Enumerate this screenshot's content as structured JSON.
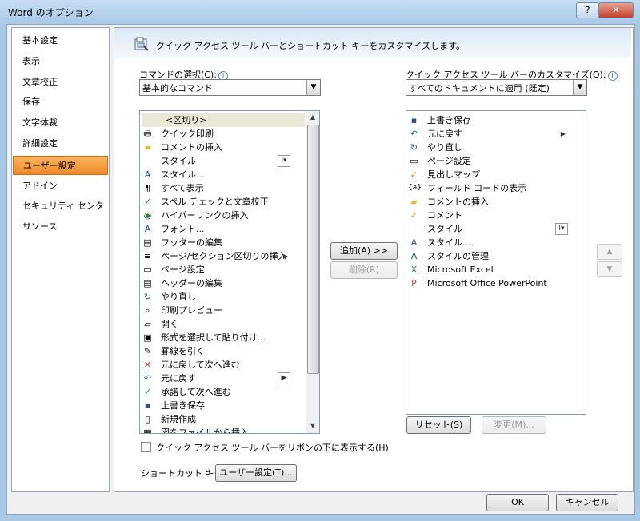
{
  "window": {
    "title": "Word のオプション",
    "help_label": "?",
    "close_label": "✕"
  },
  "nav": {
    "items": [
      {
        "label": "基本設定"
      },
      {
        "label": "表示"
      },
      {
        "label": "文章校正"
      },
      {
        "label": "保存"
      },
      {
        "label": "文字体裁"
      },
      {
        "label": "詳細設定"
      },
      {
        "label": "ユーザー設定",
        "selected": true
      },
      {
        "label": "アドイン"
      },
      {
        "label": "セキュリティ センター"
      },
      {
        "label": "リソース"
      }
    ]
  },
  "header": {
    "text": "クイック アクセス ツール バーとショートカット キーをカスタマイズします。"
  },
  "left": {
    "label": "コマンドの選択(C):",
    "combo_value": "基本的なコマンド",
    "commands": [
      {
        "label": "<区切り>",
        "icon": "separator"
      },
      {
        "label": "クイック印刷",
        "icon": "print-icon"
      },
      {
        "label": "コメントの挿入",
        "icon": "folder-icon"
      },
      {
        "label": "スタイル",
        "icon": "none",
        "dropdown": true
      },
      {
        "label": "スタイル...",
        "icon": "style-icon"
      },
      {
        "label": "すべて表示",
        "icon": "paragraph-icon"
      },
      {
        "label": "スペル チェックと文章校正",
        "icon": "spellcheck-icon"
      },
      {
        "label": "ハイパーリンクの挿入",
        "icon": "globe-icon"
      },
      {
        "label": "フォント...",
        "icon": "font-icon"
      },
      {
        "label": "フッターの編集",
        "icon": "footer-icon"
      },
      {
        "label": "ページ/セクション区切りの挿入",
        "icon": "break-icon",
        "submenu": true
      },
      {
        "label": "ページ設定",
        "icon": "page-setup-icon"
      },
      {
        "label": "ヘッダーの編集",
        "icon": "header-icon"
      },
      {
        "label": "やり直し",
        "icon": "redo-icon"
      },
      {
        "label": "印刷プレビュー",
        "icon": "preview-icon"
      },
      {
        "label": "開く",
        "icon": "open-icon"
      },
      {
        "label": "形式を選択して貼り付け...",
        "icon": "paste-icon"
      },
      {
        "label": "罫線を引く",
        "icon": "table-draw-icon"
      },
      {
        "label": "元に戻して次へ進む",
        "icon": "reject-icon"
      },
      {
        "label": "元に戻す",
        "icon": "undo-icon",
        "submenu_box": true
      },
      {
        "label": "承諾して次へ進む",
        "icon": "accept-icon"
      },
      {
        "label": "上書き保存",
        "icon": "save-icon"
      },
      {
        "label": "新規作成",
        "icon": "new-icon"
      },
      {
        "label": "図をファイルから挿入",
        "icon": "picture-icon"
      }
    ]
  },
  "right": {
    "label": "クイック アクセス ツール バーのカスタマイズ(Q):",
    "combo_value": "すべてのドキュメントに適用 (既定)",
    "items": [
      {
        "label": "上書き保存",
        "icon": "save-icon"
      },
      {
        "label": "元に戻す",
        "icon": "undo-icon",
        "submenu": true
      },
      {
        "label": "やり直し",
        "icon": "redo-icon"
      },
      {
        "label": "ページ設定",
        "icon": "page-setup-icon"
      },
      {
        "label": "見出しマップ",
        "icon": "check-icon"
      },
      {
        "label": "フィールド コードの表示",
        "icon": "field-code-icon"
      },
      {
        "label": "コメントの挿入",
        "icon": "folder-icon"
      },
      {
        "label": "コメント",
        "icon": "check-icon"
      },
      {
        "label": "スタイル",
        "icon": "none",
        "dropdown": true
      },
      {
        "label": "スタイル...",
        "icon": "style-icon"
      },
      {
        "label": "スタイルの管理",
        "icon": "manage-styles-icon"
      },
      {
        "label": "Microsoft Excel",
        "icon": "excel-icon"
      },
      {
        "label": "Microsoft Office PowerPoint",
        "icon": "powerpoint-icon"
      }
    ]
  },
  "buttons": {
    "add": "追加(A) >>",
    "remove": "削除(R)",
    "reset": "リセット(S)",
    "modify": "変更(M)...",
    "up": "▲",
    "down": "▼",
    "shortcut_customize": "ユーザー設定(T)...",
    "ok": "OK",
    "cancel": "キャンセル"
  },
  "checkbox": {
    "label": "クイック アクセス ツール バーをリボンの下に表示する(H)",
    "checked": false
  },
  "shortcut": {
    "label": "ショートカット キー:"
  },
  "colors": {
    "accent_selected": "#f0882a",
    "titlebar": "#a9c9e8",
    "header_band": "#dce9f6"
  }
}
